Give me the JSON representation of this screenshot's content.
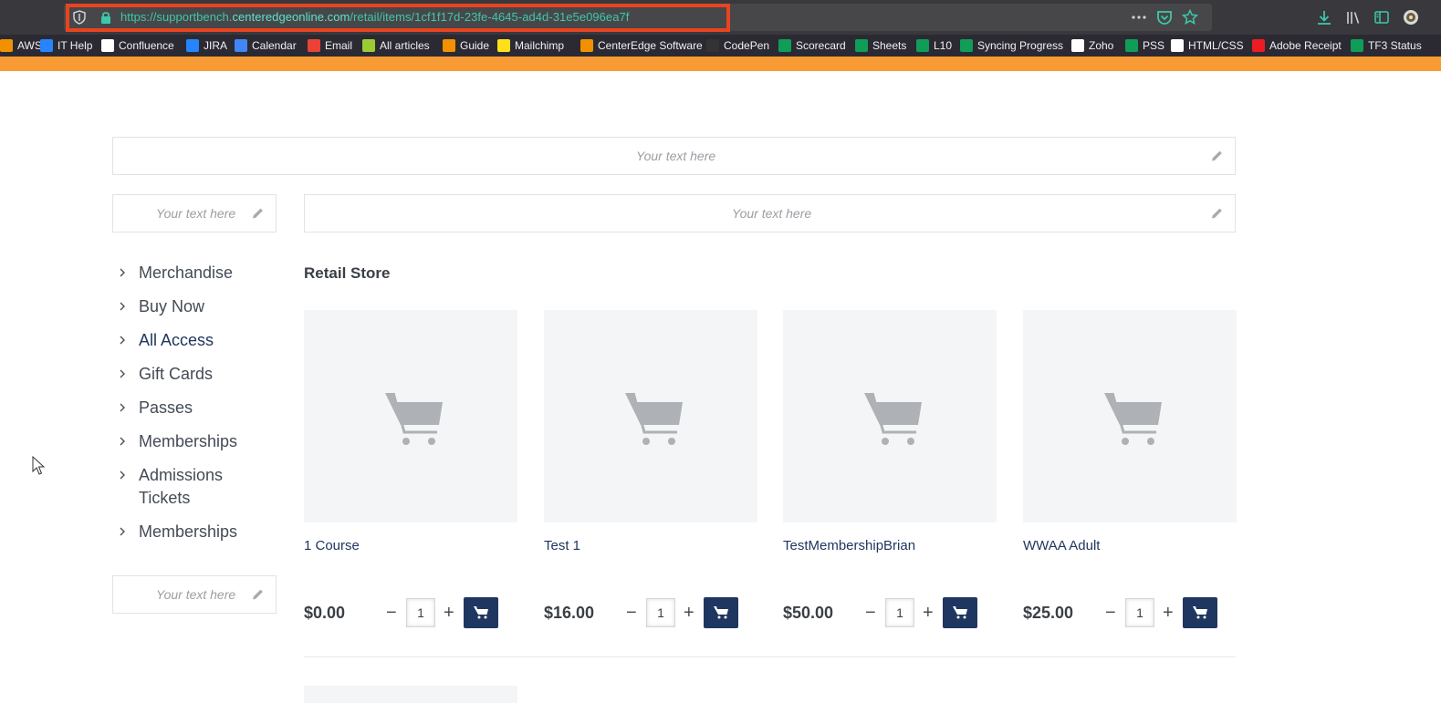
{
  "browser": {
    "url_prefix": "https://supportbench.",
    "url_domain": "centeredgeonline.com",
    "url_path": "/retail/items/1cf1f17d-23fe-4645-ad4d-31e5e096ea7f",
    "bookmarks": [
      {
        "label": "AWS",
        "color": "#f29100"
      },
      {
        "label": "IT Help",
        "color": "#2684ff"
      },
      {
        "label": "Confluence",
        "color": "#ffffff"
      },
      {
        "label": "JIRA",
        "color": "#2684ff"
      },
      {
        "label": "Calendar",
        "color": "#4285f4"
      },
      {
        "label": "Email",
        "color": "#ea4335"
      },
      {
        "label": "All articles",
        "color": "#9acd32"
      },
      {
        "label": "Guide",
        "color": "#f29100"
      },
      {
        "label": "Mailchimp",
        "color": "#ffe01b"
      },
      {
        "label": "CenterEdge Software",
        "color": "#f29100"
      },
      {
        "label": "CodePen",
        "color": "#333333"
      },
      {
        "label": "Scorecard",
        "color": "#0f9d58"
      },
      {
        "label": "Sheets",
        "color": "#0f9d58"
      },
      {
        "label": "L10",
        "color": "#0f9d58"
      },
      {
        "label": "Syncing Progress",
        "color": "#0f9d58"
      },
      {
        "label": "Zoho",
        "color": "#ffffff"
      },
      {
        "label": "PSS",
        "color": "#0f9d58"
      },
      {
        "label": "HTML/CSS",
        "color": "#ffffff"
      },
      {
        "label": "Adobe Receipt",
        "color": "#ec1c24"
      },
      {
        "label": "TF3 Status",
        "color": "#0f9d58"
      }
    ]
  },
  "page": {
    "placeholder_text": "Your text here",
    "nav_items": [
      {
        "label": "Merchandise"
      },
      {
        "label": "Buy Now"
      },
      {
        "label": "All Access"
      },
      {
        "label": "Gift Cards"
      },
      {
        "label": "Passes"
      },
      {
        "label": "Memberships"
      },
      {
        "label": "Admissions Tickets"
      },
      {
        "label": "Memberships"
      }
    ],
    "section_title": "Retail Store",
    "products": [
      {
        "name": "1 Course",
        "price": "$0.00",
        "qty": "1"
      },
      {
        "name": "Test 1",
        "price": "$16.00",
        "qty": "1"
      },
      {
        "name": "TestMembershipBrian",
        "price": "$50.00",
        "qty": "1"
      },
      {
        "name": "WWAA Adult",
        "price": "$25.00",
        "qty": "1"
      }
    ],
    "qty_minus": "−",
    "qty_plus": "+"
  },
  "colors": {
    "accent_orange": "#f99b35",
    "brand_navy": "#1f3660",
    "url_highlight": "#e8441e"
  }
}
